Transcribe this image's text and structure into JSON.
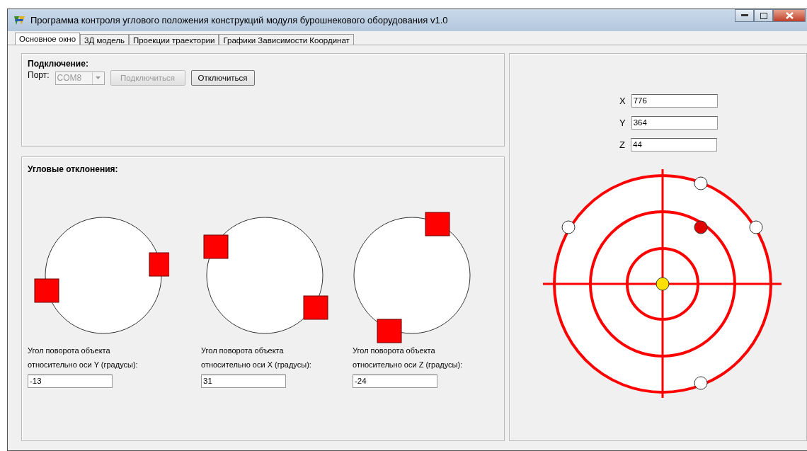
{
  "window": {
    "title": "Программа контроля углового положения конструкций модуля бурошнекового оборудования v1.0"
  },
  "tabs": [
    {
      "label": "Основное окно",
      "selected": true
    },
    {
      "label": "3Д модель",
      "selected": false
    },
    {
      "label": "Проекции траектории",
      "selected": false
    },
    {
      "label": "Графики Зависимости Координат",
      "selected": false
    }
  ],
  "connection": {
    "heading": "Подключение:",
    "port_label": "Порт:",
    "port": {
      "value": "COM8",
      "disabled": true
    },
    "buttons": [
      {
        "label": "Подключиться",
        "disabled": true
      },
      {
        "label": "Отключиться",
        "disabled": false
      }
    ]
  },
  "angles": {
    "heading": "Угловые отклонения:",
    "gauges": [
      {
        "label": "Угол поворота объекта относительно оси Y (градусы):",
        "value": "-13"
      },
      {
        "label": "Угол поворота объекта относительно оси X (градусы):",
        "value": "31"
      },
      {
        "label": "Угол поворота объекта относительно оси Z (градусы):",
        "value": "-24"
      }
    ]
  },
  "coordinates": [
    {
      "axis": "X",
      "value": "776"
    },
    {
      "axis": "Y",
      "value": "364"
    },
    {
      "axis": "Z",
      "value": "44"
    }
  ]
}
